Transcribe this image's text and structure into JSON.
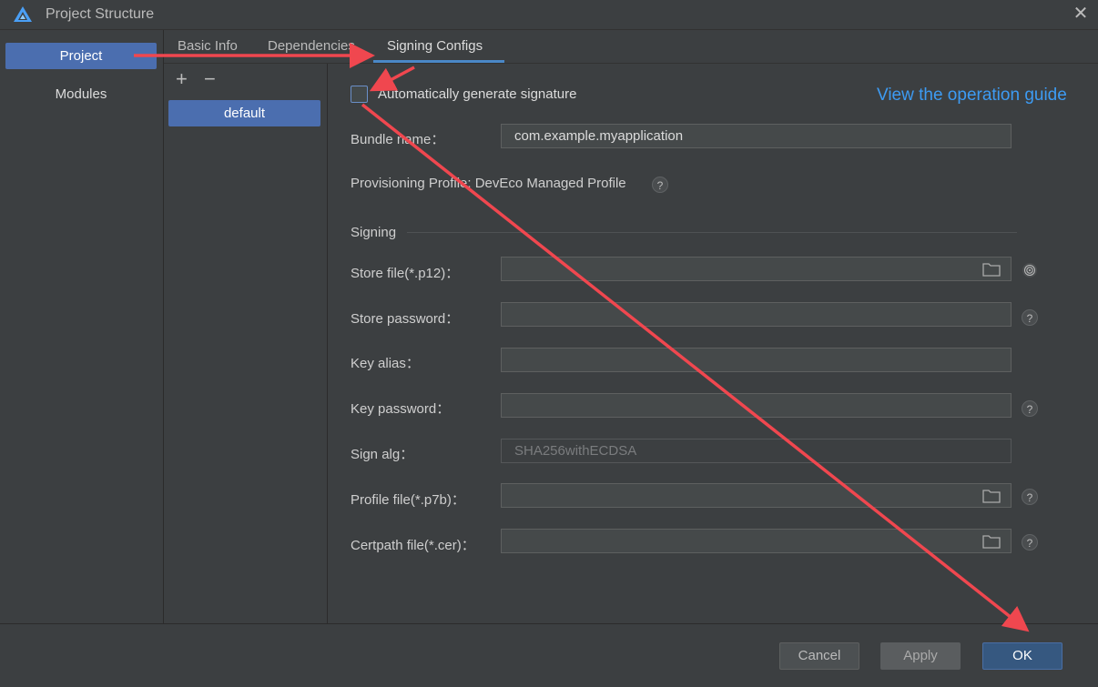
{
  "window": {
    "title": "Project Structure",
    "close_symbol": "✕",
    "logo_icon": "deveco-logo-icon"
  },
  "sidebar": {
    "items": [
      {
        "label": "Project",
        "active": true
      },
      {
        "label": "Modules",
        "active": false
      }
    ]
  },
  "tabs": [
    {
      "label": "Basic Info"
    },
    {
      "label": "Dependencies"
    },
    {
      "label": "Signing Configs",
      "active": true
    }
  ],
  "configs": {
    "add_symbol": "+",
    "remove_symbol": "−",
    "items": [
      "default"
    ]
  },
  "form": {
    "auto_sign": {
      "label": "Automatically generate signature",
      "checked": false
    },
    "guide_link": "View the operation guide",
    "bundle_name": {
      "label": "Bundle name：",
      "value": "com.example.myapplication"
    },
    "provisioning": {
      "label": "Provisioning Profile: DevEco Managed Profile"
    },
    "signing_header": "Signing",
    "store_file": {
      "label": "Store file(*.p12)：",
      "value": ""
    },
    "store_password": {
      "label": "Store password：",
      "value": ""
    },
    "key_alias": {
      "label": "Key alias：",
      "value": ""
    },
    "key_password": {
      "label": "Key password：",
      "value": ""
    },
    "sign_alg": {
      "label": "Sign alg：",
      "value": "SHA256withECDSA"
    },
    "profile_file": {
      "label": "Profile file(*.p7b)：",
      "value": ""
    },
    "certpath_file": {
      "label": "Certpath file(*.cer)：",
      "value": ""
    },
    "help_symbol": "?"
  },
  "buttons": {
    "cancel": "Cancel",
    "apply": "Apply",
    "ok": "OK"
  },
  "colors": {
    "accent": "#4b6eaf",
    "link": "#3d9bf3",
    "annotation_arrow": "#f0474f"
  }
}
